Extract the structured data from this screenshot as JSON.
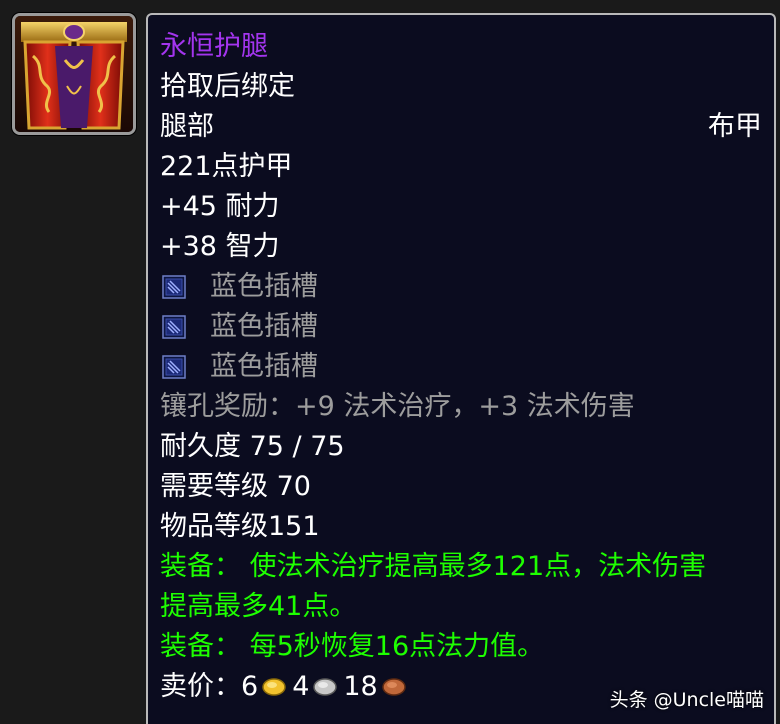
{
  "item": {
    "icon": "purple-red-cloth-leggings-icon",
    "name": "永恒护腿",
    "bind": "拾取后绑定",
    "slot": "腿部",
    "armor_type": "布甲",
    "armor": "221点护甲",
    "stats": [
      "+45 耐力",
      "+38 智力"
    ],
    "sockets": [
      {
        "label": "蓝色插槽",
        "icon": "blue-socket-icon"
      },
      {
        "label": "蓝色插槽",
        "icon": "blue-socket-icon"
      },
      {
        "label": "蓝色插槽",
        "icon": "blue-socket-icon"
      }
    ],
    "socket_bonus": "镶孔奖励：+9 法术治疗，+3 法术伤害",
    "durability": "耐久度 75 / 75",
    "required_level": "需要等级 70",
    "item_level": "物品等级151",
    "equip_effects": [
      [
        "装备：  使法术治疗提高最多121点，法术伤害",
        "提高最多41点。"
      ],
      [
        "装备：  每5秒恢复16点法力值。"
      ]
    ],
    "sell_price": {
      "label": "卖价：",
      "gold": "6",
      "silver": "4",
      "copper": "18"
    }
  },
  "colors": {
    "epic": "#a335ee",
    "uncommon_green": "#1eff00",
    "poor_gray": "#9d9d9d",
    "tooltip_bg": "#0b0c1f",
    "border": "#b9b9b9"
  },
  "watermark": "头条 @Uncle喵喵"
}
